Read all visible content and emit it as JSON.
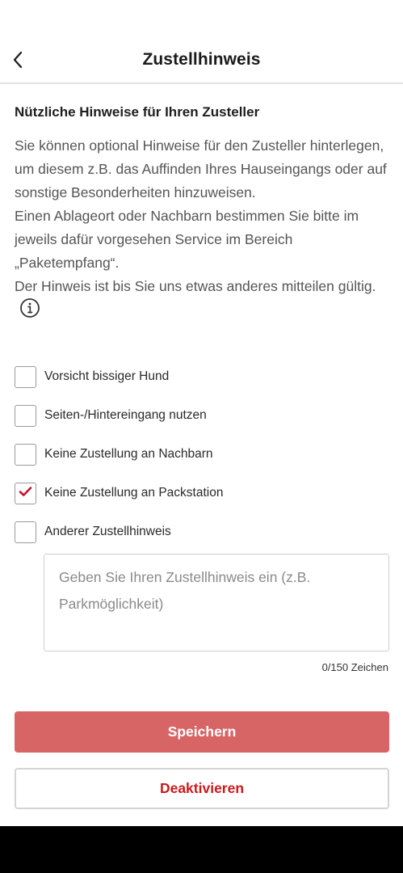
{
  "header": {
    "title": "Zustellhinweis",
    "back_icon": "chevron-left-icon"
  },
  "content": {
    "heading": "Nützliche Hinweise für Ihren Zusteller",
    "paragraph1": "Sie können optional Hinweise für den Zusteller hinterlegen, um diesem z.B. das Auffinden Ihres Hauseingangs oder auf sonstige Besonderheiten hinzuweisen.",
    "paragraph2": "Einen Ablageort oder Nachbarn bestimmen Sie bitte im jeweils dafür vorgesehen Service im Bereich „Paketempfang“.",
    "paragraph3": "Der Hinweis ist bis Sie uns etwas anderes mitteilen gültig.",
    "info_icon": "info-icon"
  },
  "options": [
    {
      "label": "Vorsicht bissiger Hund",
      "checked": false
    },
    {
      "label": "Seiten-/Hintereingang nutzen",
      "checked": false
    },
    {
      "label": "Keine Zustellung an Nachbarn",
      "checked": false
    },
    {
      "label": "Keine Zustellung an Packstation",
      "checked": true
    },
    {
      "label": "Anderer Zustellhinweis",
      "checked": false
    }
  ],
  "note_field": {
    "value": "",
    "placeholder": "Geben Sie Ihren Zustellhinweis ein (z.B. Parkmöglichkeit)",
    "counter": "0/150 Zeichen"
  },
  "buttons": {
    "save_label": "Speichern",
    "deactivate_label": "Deaktivieren"
  },
  "colors": {
    "primary_button": "#d86566",
    "accent_red": "#cc1a1a",
    "checkmark": "#c8102e"
  }
}
